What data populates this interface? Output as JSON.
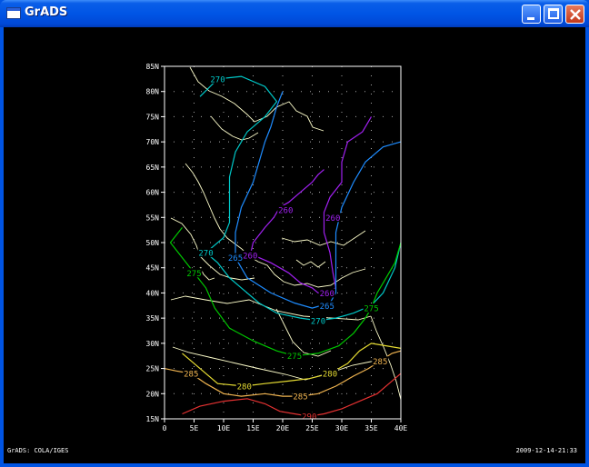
{
  "window": {
    "title": "GrADS",
    "buttons": {
      "minimize": "minimize",
      "maximize": "maximize",
      "close": "close"
    }
  },
  "footer": {
    "left": "GrADS: COLA/IGES",
    "right": "2009-12-14-21:33"
  },
  "colors": {
    "c270": "#00c8c8",
    "c265": "#1e8cff",
    "c260": "#a020f0",
    "c275": "#00c800",
    "c280": "#e6dc32",
    "c285": "#f0b450",
    "c290": "#e63232",
    "coast": "#ffffcc"
  },
  "chart_data": {
    "type": "contour",
    "x": {
      "min": 0,
      "max": 40,
      "ticks": [
        0,
        5,
        10,
        15,
        20,
        25,
        30,
        35,
        40
      ],
      "labels": [
        "0",
        "5E",
        "10E",
        "15E",
        "20E",
        "25E",
        "30E",
        "35E",
        "40E"
      ]
    },
    "y": {
      "min": 15,
      "max": 85,
      "ticks": [
        15,
        20,
        25,
        30,
        35,
        40,
        45,
        50,
        55,
        60,
        65,
        70,
        75,
        80,
        85
      ],
      "labels": [
        "15N",
        "20N",
        "25N",
        "30N",
        "35N",
        "40N",
        "45N",
        "50N",
        "55N",
        "60N",
        "65N",
        "70N",
        "75N",
        "80N",
        "85N"
      ]
    },
    "grid": true,
    "contours": [
      {
        "level": "260",
        "colorKey": "c260",
        "labels": [
          {
            "x": 20.5,
            "y": 56.5
          },
          {
            "x": 28.5,
            "y": 55
          },
          {
            "x": 14.5,
            "y": 47.5
          },
          {
            "x": 27.5,
            "y": 40
          }
        ],
        "points": [
          [
            35,
            75
          ],
          [
            33.5,
            72
          ],
          [
            31,
            70
          ],
          [
            30,
            66
          ],
          [
            30,
            62
          ],
          [
            28,
            59
          ],
          [
            27,
            56
          ],
          [
            27,
            52
          ],
          [
            28,
            48
          ],
          [
            28.5,
            44
          ],
          [
            29,
            41
          ],
          [
            28,
            40.5
          ],
          [
            26,
            40
          ],
          [
            25,
            41
          ],
          [
            23,
            42
          ],
          [
            21,
            44
          ],
          [
            18,
            46
          ],
          [
            16,
            47
          ],
          [
            14.5,
            47.5
          ],
          [
            15,
            50
          ],
          [
            17,
            53
          ],
          [
            18.5,
            55
          ],
          [
            19.5,
            57
          ],
          [
            21,
            58
          ],
          [
            23,
            60
          ],
          [
            25,
            62
          ],
          [
            26,
            63.5
          ],
          [
            27,
            64.5
          ]
        ]
      },
      {
        "level": "265",
        "colorKey": "c265",
        "labels": [
          {
            "x": 12,
            "y": 47
          },
          {
            "x": 27.5,
            "y": 37.5
          }
        ],
        "points": [
          [
            40,
            70
          ],
          [
            37,
            69
          ],
          [
            34,
            66
          ],
          [
            32,
            62
          ],
          [
            30,
            57
          ],
          [
            29,
            52
          ],
          [
            29,
            47
          ],
          [
            29,
            43
          ],
          [
            29,
            40
          ],
          [
            28,
            38
          ],
          [
            25,
            37
          ],
          [
            22,
            38
          ],
          [
            18,
            40
          ],
          [
            14,
            43
          ],
          [
            12,
            47
          ],
          [
            12,
            52
          ],
          [
            13,
            57
          ],
          [
            15,
            62
          ],
          [
            16,
            66
          ],
          [
            17,
            70
          ],
          [
            18,
            73
          ],
          [
            19,
            77
          ],
          [
            20,
            80
          ]
        ]
      },
      {
        "level": "270",
        "colorKey": "c270",
        "labels": [
          {
            "x": 9,
            "y": 82.5
          },
          {
            "x": 7,
            "y": 48
          },
          {
            "x": 26,
            "y": 34.5
          }
        ],
        "points": [
          [
            6,
            79
          ],
          [
            9,
            82.5
          ],
          [
            13,
            83
          ],
          [
            17,
            81
          ],
          [
            19,
            78
          ],
          [
            17,
            75
          ],
          [
            14,
            72
          ],
          [
            12,
            68
          ],
          [
            11,
            63
          ],
          [
            11,
            58
          ],
          [
            11,
            54
          ],
          [
            10,
            51
          ],
          [
            7,
            48
          ],
          [
            9,
            46
          ],
          [
            11,
            43
          ],
          [
            13,
            41
          ],
          [
            16,
            38
          ],
          [
            19,
            36
          ],
          [
            23,
            35
          ],
          [
            26,
            34.5
          ],
          [
            29,
            35
          ],
          [
            32,
            36
          ],
          [
            35,
            37.5
          ],
          [
            37,
            40
          ],
          [
            39,
            45
          ],
          [
            40,
            50
          ]
        ]
      },
      {
        "level": "275",
        "colorKey": "c275",
        "labels": [
          {
            "x": 5,
            "y": 44
          },
          {
            "x": 22,
            "y": 27.5
          },
          {
            "x": 35,
            "y": 37
          }
        ],
        "points": [
          [
            3,
            53
          ],
          [
            1,
            50
          ],
          [
            3,
            47
          ],
          [
            5,
            44
          ],
          [
            7,
            41
          ],
          [
            8.5,
            37
          ],
          [
            11,
            33
          ],
          [
            15,
            30.5
          ],
          [
            19,
            28.5
          ],
          [
            22,
            27.5
          ],
          [
            26,
            28
          ],
          [
            29.5,
            29.5
          ],
          [
            32,
            32
          ],
          [
            34,
            35
          ],
          [
            35,
            37
          ],
          [
            36,
            40
          ],
          [
            37.5,
            43
          ],
          [
            39,
            46
          ],
          [
            40,
            50
          ]
        ]
      },
      {
        "level": "280",
        "colorKey": "c280",
        "labels": [
          {
            "x": 13.5,
            "y": 21.5
          },
          {
            "x": 28,
            "y": 24
          }
        ],
        "points": [
          [
            3,
            28
          ],
          [
            6,
            25
          ],
          [
            9,
            22
          ],
          [
            13.5,
            21.5
          ],
          [
            17,
            22
          ],
          [
            21,
            22.5
          ],
          [
            24.5,
            23
          ],
          [
            28,
            24
          ],
          [
            31,
            26
          ],
          [
            33,
            28.5
          ],
          [
            35,
            30
          ],
          [
            37.5,
            29.5
          ],
          [
            40,
            29
          ]
        ]
      },
      {
        "level": "285",
        "colorKey": "c285",
        "labels": [
          {
            "x": 4.5,
            "y": 24
          },
          {
            "x": 23,
            "y": 19.5
          },
          {
            "x": 36.5,
            "y": 26.5
          }
        ],
        "points": [
          [
            0,
            25
          ],
          [
            2,
            24.5
          ],
          [
            4.5,
            24
          ],
          [
            7,
            22
          ],
          [
            10,
            20
          ],
          [
            13,
            19.5
          ],
          [
            17,
            20
          ],
          [
            20,
            19.5
          ],
          [
            23,
            19.5
          ],
          [
            26,
            20
          ],
          [
            29,
            21.5
          ],
          [
            32,
            23.5
          ],
          [
            34.5,
            25
          ],
          [
            36.5,
            26.5
          ],
          [
            38.5,
            28
          ],
          [
            40,
            28.5
          ]
        ]
      },
      {
        "level": "290",
        "colorKey": "c290",
        "labels": [
          {
            "x": 24.5,
            "y": 15.5
          }
        ],
        "points": [
          [
            3,
            16
          ],
          [
            6,
            17.5
          ],
          [
            10,
            18.5
          ],
          [
            14,
            19
          ],
          [
            17,
            18
          ],
          [
            19.5,
            16.5
          ],
          [
            22,
            16
          ],
          [
            24.5,
            15.5
          ],
          [
            27,
            16
          ],
          [
            30,
            17
          ],
          [
            33,
            18.5
          ],
          [
            36,
            20
          ],
          [
            38,
            22
          ],
          [
            40,
            24
          ]
        ]
      }
    ]
  }
}
